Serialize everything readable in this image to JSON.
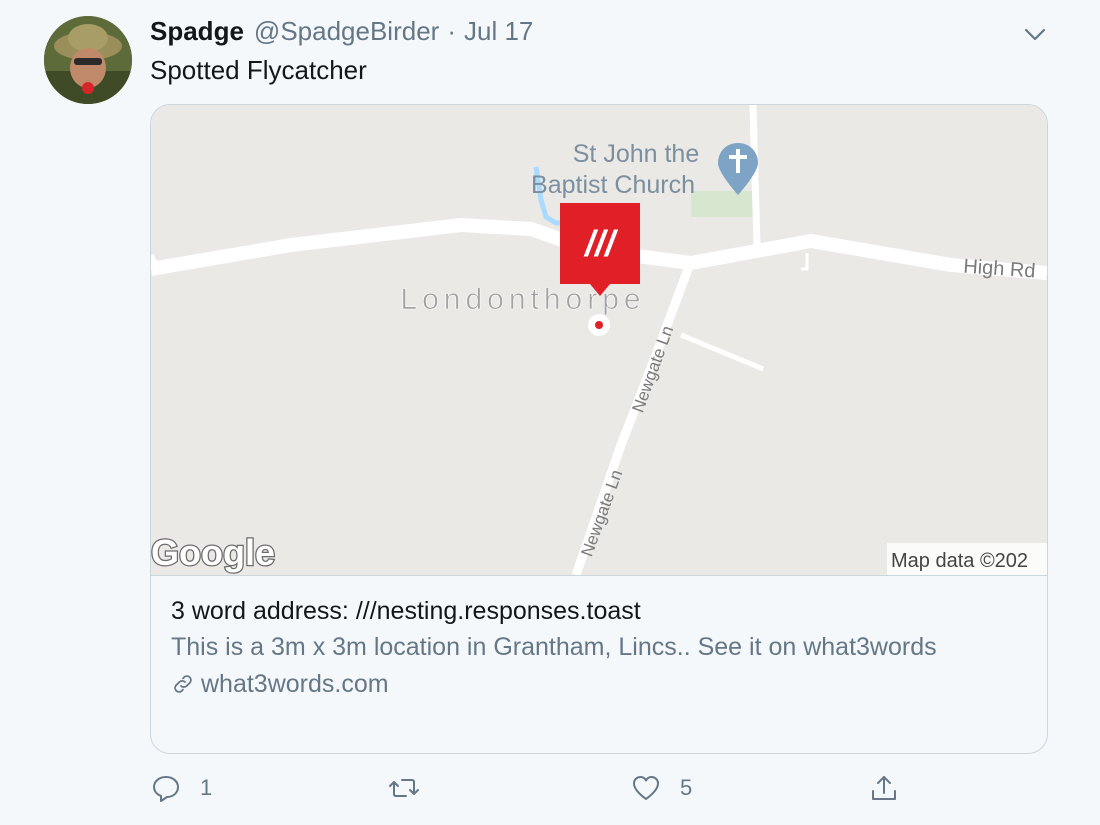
{
  "user": {
    "name": "Spadge",
    "handle": "@SpadgeBirder",
    "separator": "·",
    "date": "Jul 17"
  },
  "tweet": {
    "text": "Spotted Flycatcher"
  },
  "map": {
    "church_line1": "St John the",
    "church_line2": "Baptist Church",
    "village": "Londonthorpe",
    "road_high": "High Rd",
    "road_newgate_1": "Newgate Ln",
    "road_newgate_2": "Newgate Ln",
    "pin_label": "///",
    "logo": "Google",
    "attribution": "Map data ©202"
  },
  "card": {
    "title": "3 word address: ///nesting.responses.toast",
    "description": "This is a 3m x 3m location in Grantham, Lincs.. See it on what3words",
    "link": "what3words.com"
  },
  "actions": {
    "replies": "1",
    "retweets": "",
    "likes": "5"
  },
  "colors": {
    "accent_red": "#e11f26",
    "secondary_text": "#657786",
    "border": "#ccd6dd"
  },
  "icons": {
    "reply": "reply-icon",
    "retweet": "retweet-icon",
    "like": "heart-icon",
    "share": "share-icon",
    "menu": "chevron-down-icon",
    "link": "link-icon"
  }
}
